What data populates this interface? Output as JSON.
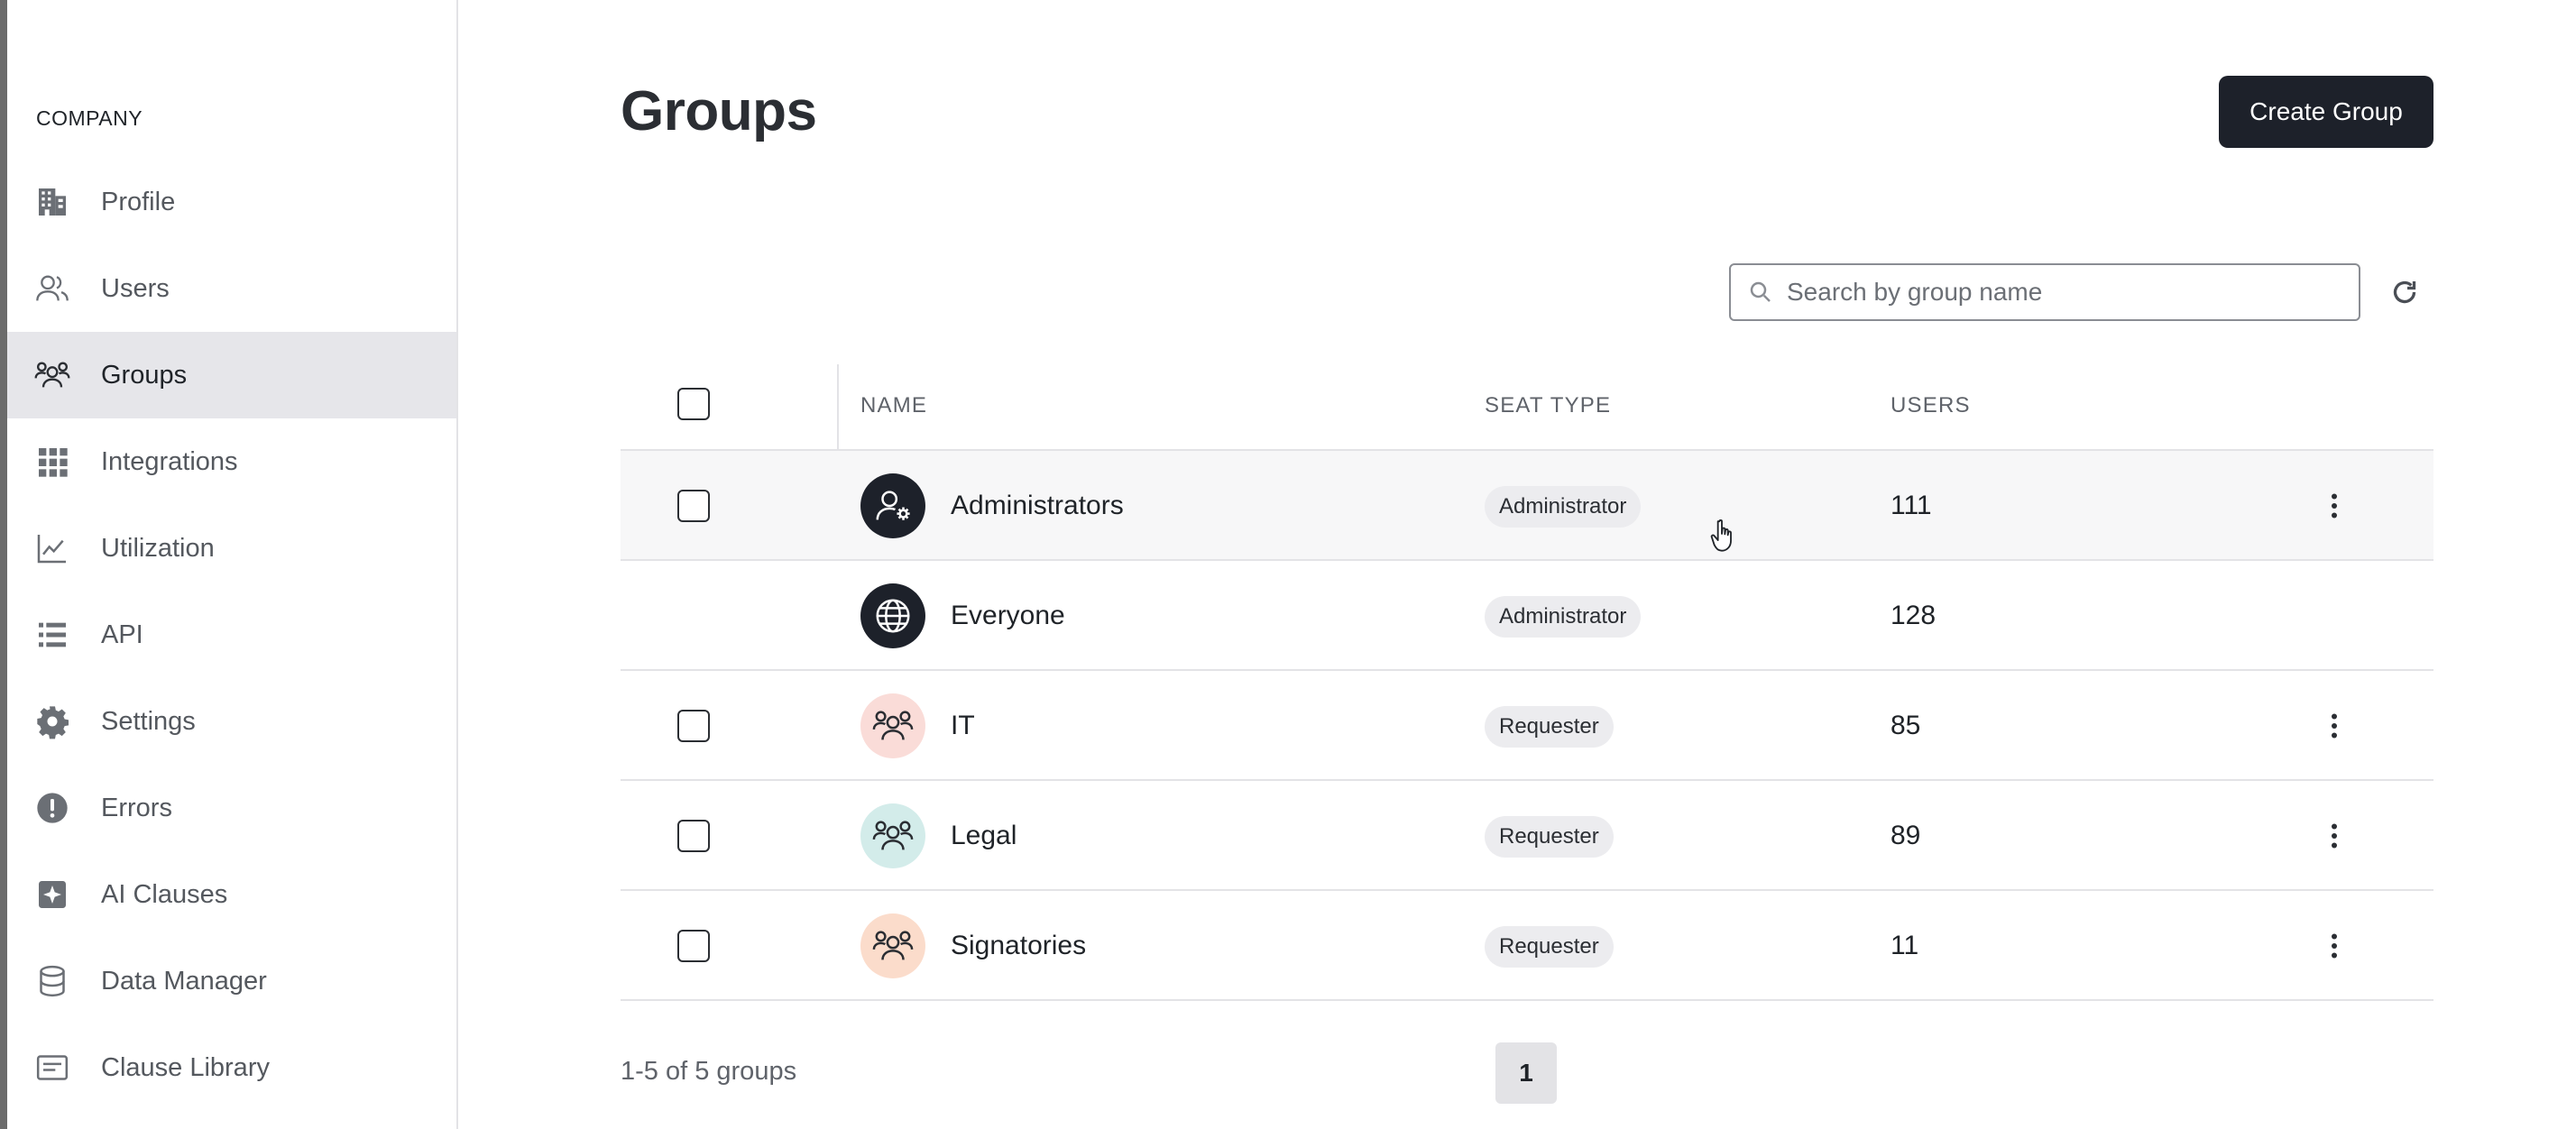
{
  "sidebar": {
    "section_title": "COMPANY",
    "items": [
      {
        "label": "Profile",
        "icon": "building-icon"
      },
      {
        "label": "Users",
        "icon": "users-icon"
      },
      {
        "label": "Groups",
        "icon": "groups-icon",
        "active": true
      },
      {
        "label": "Integrations",
        "icon": "grid-icon"
      },
      {
        "label": "Utilization",
        "icon": "line-chart-icon"
      },
      {
        "label": "API",
        "icon": "list-icon"
      },
      {
        "label": "Settings",
        "icon": "gear-icon"
      },
      {
        "label": "Errors",
        "icon": "alert-icon"
      },
      {
        "label": "AI Clauses",
        "icon": "sparkle-icon"
      },
      {
        "label": "Data Manager",
        "icon": "database-icon"
      },
      {
        "label": "Clause Library",
        "icon": "card-text-icon"
      }
    ]
  },
  "header": {
    "title": "Groups",
    "create_button": "Create Group"
  },
  "search": {
    "placeholder": "Search by group name"
  },
  "table": {
    "columns": {
      "name": "NAME",
      "seat_type": "SEAT TYPE",
      "users": "USERS"
    },
    "rows": [
      {
        "name": "Administrators",
        "seat_type": "Administrator",
        "users": "111",
        "avatar": "admin-gear-icon",
        "avatar_bg": "#1d212a",
        "checkbox": true,
        "menu": true
      },
      {
        "name": "Everyone",
        "seat_type": "Administrator",
        "users": "128",
        "avatar": "globe-icon",
        "avatar_bg": "#1d212a",
        "checkbox": false,
        "menu": false
      },
      {
        "name": "IT",
        "seat_type": "Requester",
        "users": "85",
        "avatar": "groups-icon",
        "avatar_bg": "#fadcd8",
        "checkbox": true,
        "menu": true
      },
      {
        "name": "Legal",
        "seat_type": "Requester",
        "users": "89",
        "avatar": "groups-icon",
        "avatar_bg": "#d3ecea",
        "checkbox": true,
        "menu": true
      },
      {
        "name": "Signatories",
        "seat_type": "Requester",
        "users": "11",
        "avatar": "groups-icon",
        "avatar_bg": "#fbdccb",
        "checkbox": true,
        "menu": true
      }
    ]
  },
  "pagination": {
    "summary": "1-5 of 5 groups",
    "current_page": "1"
  }
}
